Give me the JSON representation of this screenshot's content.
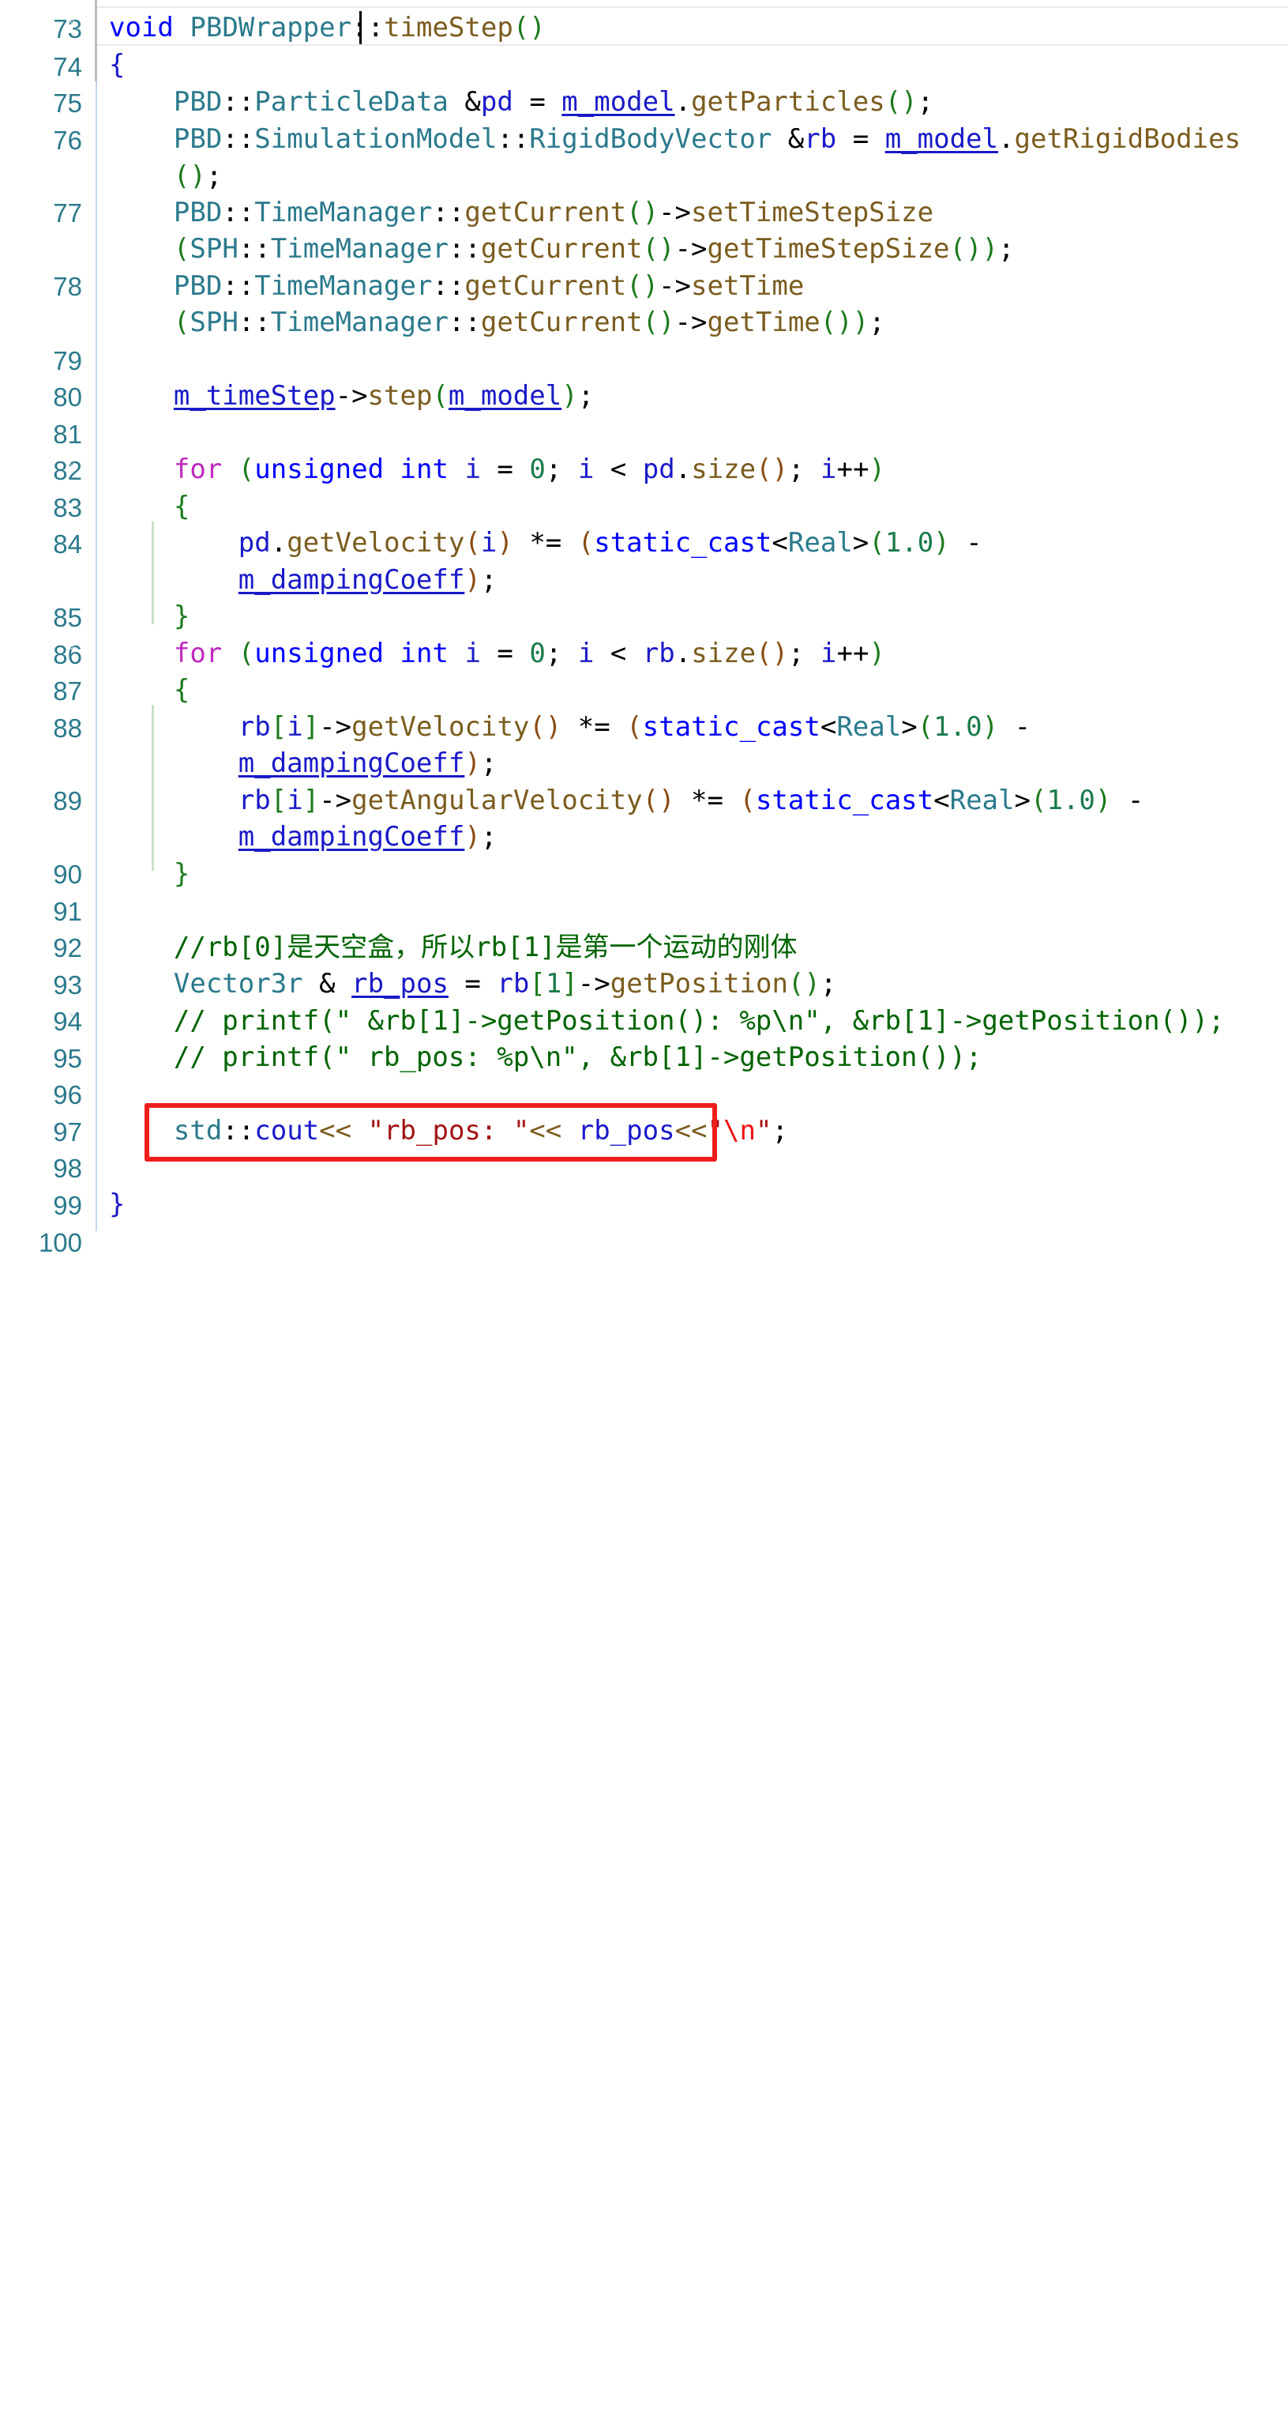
{
  "app": {
    "kind": "code-editor",
    "language": "C++",
    "theme": "light",
    "font_size_px": 34
  },
  "colors": {
    "background": "#ffffff",
    "line_number": "#2b7a8c",
    "keyword": "#0000ff",
    "keyword_control": "#bf2bbf",
    "type": "#2b7a8c",
    "function": "#7a5c1e",
    "variable": "#1a1ac8",
    "member_variable": "#1a1ac8",
    "number": "#1a7a4a",
    "comment": "#006400",
    "string": "#a31515",
    "escape": "#ee1111",
    "paren": "#1a7a1a",
    "annotation_box": "#f01d1d",
    "current_line_border": "#eaeaea",
    "indent_guide": "#c8d4f0",
    "block_guide": "#c9dfc9"
  },
  "gutter": {
    "line_numbers": [
      "73",
      "74",
      "75",
      "76",
      "77",
      "78",
      "79",
      "80",
      "81",
      "82",
      "83",
      "84",
      "85",
      "86",
      "87",
      "88",
      "89",
      "90",
      "91",
      "92",
      "93",
      "94",
      "95",
      "96",
      "97",
      "98",
      "99",
      "100"
    ],
    "fold_markers": [
      "73",
      "82",
      "86",
      "94"
    ]
  },
  "cursor": {
    "line": 73,
    "column": 22,
    "after_text": "void PBDWrapper::"
  },
  "annotation": {
    "type": "red-rectangle",
    "target_line": 97,
    "target_text": "std::cout<< \"rb_pos: \"<< rb_pos<<\"\\n\";"
  },
  "code": {
    "lines": [
      {
        "number": "73",
        "text": "void PBDWrapper::timeStep()"
      },
      {
        "number": "74",
        "text": "{"
      },
      {
        "number": "75",
        "text": "    PBD::ParticleData &pd = m_model.getParticles();"
      },
      {
        "number": "76",
        "text": "    PBD::SimulationModel::RigidBodyVector &rb = m_model.getRigidBodies();"
      },
      {
        "number": "77",
        "text": "    PBD::TimeManager::getCurrent()->setTimeStepSize(SPH::TimeManager::getCurrent()->getTimeStepSize());"
      },
      {
        "number": "78",
        "text": "    PBD::TimeManager::getCurrent()->setTime(SPH::TimeManager::getCurrent()->getTime());"
      },
      {
        "number": "79",
        "text": ""
      },
      {
        "number": "80",
        "text": "    m_timeStep->step(m_model);"
      },
      {
        "number": "81",
        "text": ""
      },
      {
        "number": "82",
        "text": "    for (unsigned int i = 0; i < pd.size(); i++)"
      },
      {
        "number": "83",
        "text": "    {"
      },
      {
        "number": "84",
        "text": "        pd.getVelocity(i) *= (static_cast<Real>(1.0) - m_dampingCoeff);"
      },
      {
        "number": "85",
        "text": "    }"
      },
      {
        "number": "86",
        "text": "    for (unsigned int i = 0; i < rb.size(); i++)"
      },
      {
        "number": "87",
        "text": "    {"
      },
      {
        "number": "88",
        "text": "        rb[i]->getVelocity() *= (static_cast<Real>(1.0) - m_dampingCoeff);"
      },
      {
        "number": "89",
        "text": "        rb[i]->getAngularVelocity() *= (static_cast<Real>(1.0) - m_dampingCoeff);"
      },
      {
        "number": "90",
        "text": "    }"
      },
      {
        "number": "91",
        "text": ""
      },
      {
        "number": "92",
        "text": "    //rb[0]是天空盒，所以rb[1]是第一个运动的刚体"
      },
      {
        "number": "93",
        "text": "    Vector3r & rb_pos = rb[1]->getPosition();"
      },
      {
        "number": "94",
        "text": "    // printf(\" &rb[1]->getPosition(): %p\\n\", &rb[1]->getPosition());"
      },
      {
        "number": "95",
        "text": "    // printf(\" rb_pos: %p\\n\", &rb[1]->getPosition());"
      },
      {
        "number": "96",
        "text": ""
      },
      {
        "number": "97",
        "text": "    std::cout<< \"rb_pos: \"<< rb_pos<<\"\\n\";"
      },
      {
        "number": "98",
        "text": ""
      },
      {
        "number": "99",
        "text": "}"
      },
      {
        "number": "100",
        "text": ""
      }
    ],
    "wrapped_segments": {
      "76": [
        "PBD::SimulationModel::RigidBodyVector &rb = m_model.getRigidBodies",
        "();"
      ],
      "77": [
        "PBD::TimeManager::getCurrent()->setTimeStepSize",
        "(SPH::TimeManager::getCurrent()->getTimeStepSize());"
      ],
      "78": [
        "PBD::TimeManager::getCurrent()->setTime",
        "(SPH::TimeManager::getCurrent()->getTime());"
      ],
      "84": [
        "pd.getVelocity(i) *= (static_cast<Real>(1.0) -",
        "m_dampingCoeff);"
      ],
      "88": [
        "rb[i]->getVelocity() *= (static_cast<Real>(1.0) -",
        "m_dampingCoeff);"
      ],
      "89": [
        "rb[i]->getAngularVelocity() *= (static_cast<Real>(1.0) -",
        "m_dampingCoeff);"
      ]
    }
  }
}
